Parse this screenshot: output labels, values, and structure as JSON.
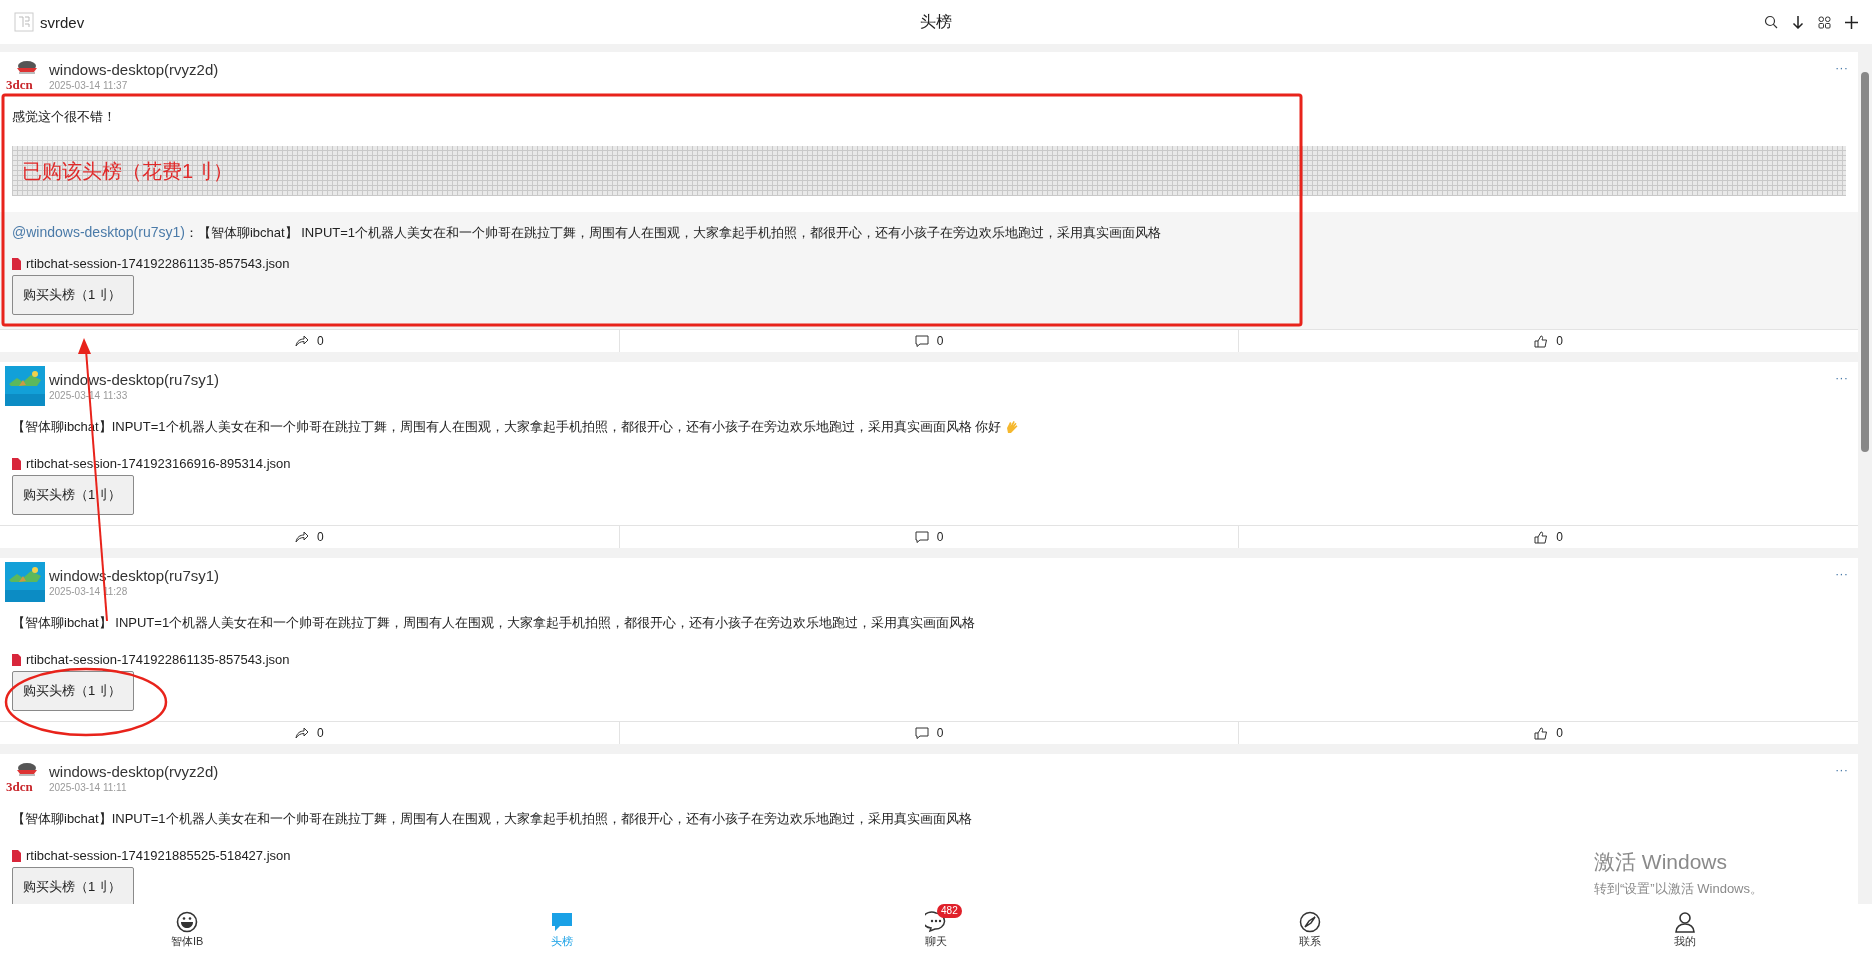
{
  "header": {
    "app_name": "svrdev",
    "title": "头榜"
  },
  "posts": [
    {
      "avatar": {
        "kind": "logo",
        "text": "3dcn"
      },
      "author": "windows-desktop(rvyz2d)",
      "time": "2025-03-14 11:37",
      "more": "···",
      "body": "感觉这个很不错！",
      "purchased": "已购该头榜（花费1刂）",
      "quote": {
        "mention": "@windows-desktop(ru7sy1)",
        "text": "：【智体聊ibchat】 INPUT=1个机器人美女在和一个帅哥在跳拉丁舞，周围有人在围观，大家拿起手机拍照，都很开心，还有小孩子在旁边欢乐地跑过，采用真实画面风格"
      },
      "file": "rtibchat-session-1741922861135-857543.json",
      "button": "购买头榜（1刂）",
      "wave": false,
      "actions": [
        {
          "kind": "share",
          "count": "0"
        },
        {
          "kind": "comment",
          "count": "0"
        },
        {
          "kind": "like",
          "count": "0"
        }
      ]
    },
    {
      "avatar": {
        "kind": "picture"
      },
      "author": "windows-desktop(ru7sy1)",
      "time": "2025-03-14 11:33",
      "more": "···",
      "body": "【智体聊ibchat】INPUT=1个机器人美女在和一个帅哥在跳拉丁舞，周围有人在围观，大家拿起手机拍照，都很开心，还有小孩子在旁边欢乐地跑过，采用真实画面风格 你好",
      "wave": true,
      "file": "rtibchat-session-1741923166916-895314.json",
      "button": "购买头榜（1刂）",
      "actions": [
        {
          "kind": "share",
          "count": "0"
        },
        {
          "kind": "comment",
          "count": "0"
        },
        {
          "kind": "like",
          "count": "0"
        }
      ]
    },
    {
      "avatar": {
        "kind": "picture"
      },
      "author": "windows-desktop(ru7sy1)",
      "time": "2025-03-14 11:28",
      "more": "···",
      "body": "【智体聊ibchat】 INPUT=1个机器人美女在和一个帅哥在跳拉丁舞，周围有人在围观，大家拿起手机拍照，都很开心，还有小孩子在旁边欢乐地跑过，采用真实画面风格",
      "wave": false,
      "file": "rtibchat-session-1741922861135-857543.json",
      "button": "购买头榜（1刂）",
      "actions": [
        {
          "kind": "share",
          "count": "0"
        },
        {
          "kind": "comment",
          "count": "0"
        },
        {
          "kind": "like",
          "count": "0"
        }
      ]
    },
    {
      "avatar": {
        "kind": "logo",
        "text": "3dcn"
      },
      "author": "windows-desktop(rvyz2d)",
      "time": "2025-03-14 11:11",
      "more": "···",
      "body": "【智体聊ibchat】INPUT=1个机器人美女在和一个帅哥在跳拉丁舞，周围有人在围观，大家拿起手机拍照，都很开心，还有小孩子在旁边欢乐地跑过，采用真实画面风格",
      "wave": false,
      "file": "rtibchat-session-1741921885525-518427.json",
      "button": "购买头榜（1刂）"
    }
  ],
  "nav": [
    {
      "kind": "smiley",
      "label": "智体IB",
      "selected": false
    },
    {
      "kind": "bubble",
      "label": "头榜",
      "selected": true
    },
    {
      "kind": "chat",
      "label": "聊天",
      "selected": false,
      "badge": "482"
    },
    {
      "kind": "compass",
      "label": "联系",
      "selected": false
    },
    {
      "kind": "person",
      "label": "我的",
      "selected": false
    }
  ],
  "watermark": {
    "title": "激活 Windows",
    "hint": "转到“设置”以激活 Windows。"
  }
}
